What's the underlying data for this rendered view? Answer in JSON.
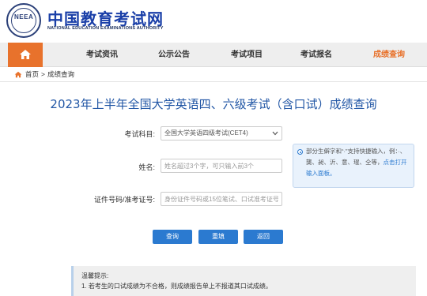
{
  "header": {
    "site_name": "中国教育考试网",
    "site_subtitle": "NATIONAL EDUCATION EXAMINATIONS AUTHORITY",
    "seal_text": "NEEA"
  },
  "nav": {
    "items": [
      {
        "label": "考试资讯"
      },
      {
        "label": "公示公告"
      },
      {
        "label": "考试项目"
      },
      {
        "label": "考试报名"
      },
      {
        "label": "成绩查询"
      }
    ],
    "active_index": 4,
    "accent_color": "#e8722c"
  },
  "breadcrumb": {
    "home": "首页",
    "separator": ">",
    "current": "成绩查询"
  },
  "page": {
    "title": "2023年上半年全国大学英语四、六级考试（含口试）成绩查询"
  },
  "form": {
    "subject_label": "考试科目:",
    "subject_value": "全国大学英语四级考试(CET4)",
    "name_label": "姓名:",
    "name_placeholder": "姓名超过3个字，可只输入前3个",
    "id_label": "证件号码/准考证号:",
    "id_placeholder": "身份证件号码或15位笔试、口试准考证号"
  },
  "tip": {
    "text": "部分生僻字和“·”支持快捷输入，例：·、龑、昶、沂、意、瑆、仝等，",
    "link": "点击打开输入面板。"
  },
  "buttons": {
    "query": "查询",
    "reset": "重填",
    "back": "返回"
  },
  "notice": {
    "heading": "温馨提示:",
    "line1": "1. 若考生的口试成绩为不合格，则成绩报告单上不报道其口试成绩。"
  },
  "colors": {
    "brand_blue": "#2156a5",
    "button_blue": "#2b7ad0",
    "nav_orange": "#e8722c"
  }
}
